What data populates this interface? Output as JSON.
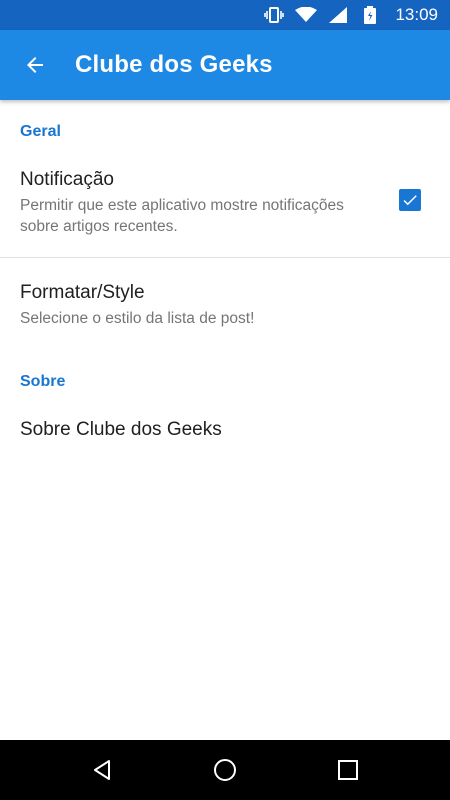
{
  "status_bar": {
    "time": "13:09",
    "icons": [
      "vibrate-icon",
      "wifi-icon",
      "signal-icon",
      "battery-icon"
    ]
  },
  "app_bar": {
    "title": "Clube dos Geeks",
    "back_icon": "arrow-back-icon"
  },
  "sections": [
    {
      "header": "Geral",
      "prefs": [
        {
          "title": "Notificação",
          "summary": "Permitir que este aplicativo mostre notificações sobre artigos recentes.",
          "checked": true
        },
        {
          "title": "Formatar/Style",
          "summary": "Selecione o estilo da lista de post!"
        }
      ]
    },
    {
      "header": "Sobre",
      "prefs": [
        {
          "title": "Sobre Clube dos Geeks"
        }
      ]
    }
  ],
  "nav_bar": {
    "buttons": [
      "back-triangle-icon",
      "home-circle-icon",
      "recents-square-icon"
    ]
  },
  "colors": {
    "status_bar": "#1565c0",
    "app_bar": "#1e88e5",
    "accent": "#1976d2"
  }
}
